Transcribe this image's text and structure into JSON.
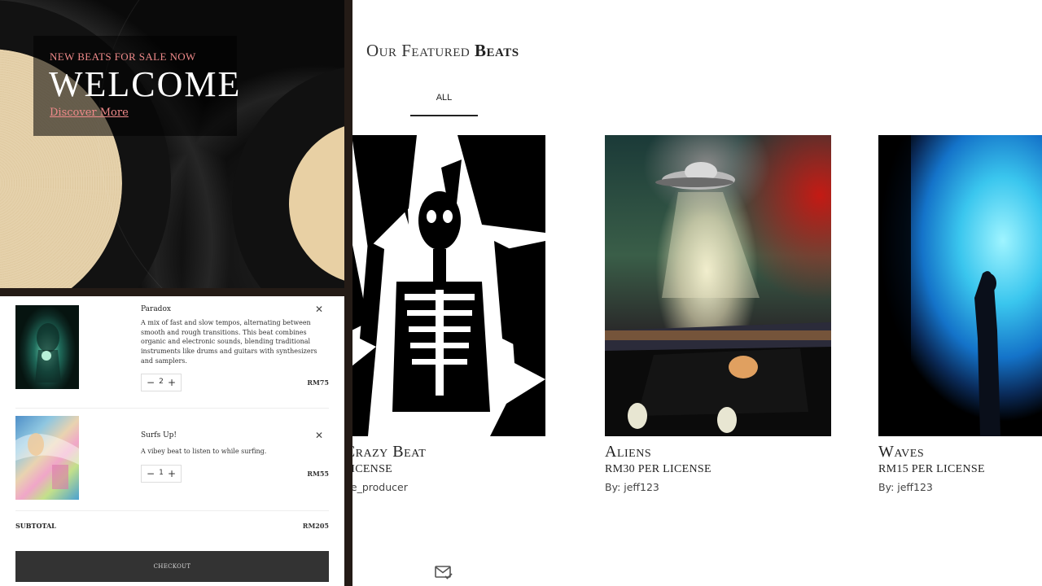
{
  "hero": {
    "eyebrow": "NEW BEATS FOR SALE NOW",
    "title": "WELCOME",
    "link": "Discover More"
  },
  "featured": {
    "title_prefix": "Our Featured ",
    "title_bold": "Beats",
    "tabs": [
      {
        "label": "ALL"
      }
    ],
    "beats": [
      {
        "title": "m's Crazy Beat",
        "price": "PER LICENSE",
        "author": "om_the_producer"
      },
      {
        "title": "Aliens",
        "price": "RM30 PER LICENSE",
        "author": "By: jeff123"
      },
      {
        "title": "Waves",
        "price": "RM15 PER LICENSE",
        "author": "By: jeff123"
      }
    ]
  },
  "cart": {
    "items": [
      {
        "name": "Paradox",
        "description": "A mix of fast and slow tempos, alternating between smooth and rough transitions. This beat combines organic and electronic sounds, blending traditional instruments like drums and guitars with synthesizers and samplers.",
        "quantity": "2",
        "price": "RM75"
      },
      {
        "name": "Surfs Up!",
        "description": "A vibey beat to listen to while surfing.",
        "quantity": "1",
        "price": "RM55"
      }
    ],
    "subtotal_label": "SUBTOTAL",
    "subtotal_value": "RM205",
    "checkout_label": "CHECKOUT"
  },
  "icons": {
    "remove": "close-icon",
    "minus": "minus-icon",
    "plus": "plus-icon",
    "mail": "mail-check-icon"
  },
  "colors": {
    "accent_pink": "#f08a8a",
    "checkout_bg": "#333333",
    "frame_dark": "#241b16"
  }
}
